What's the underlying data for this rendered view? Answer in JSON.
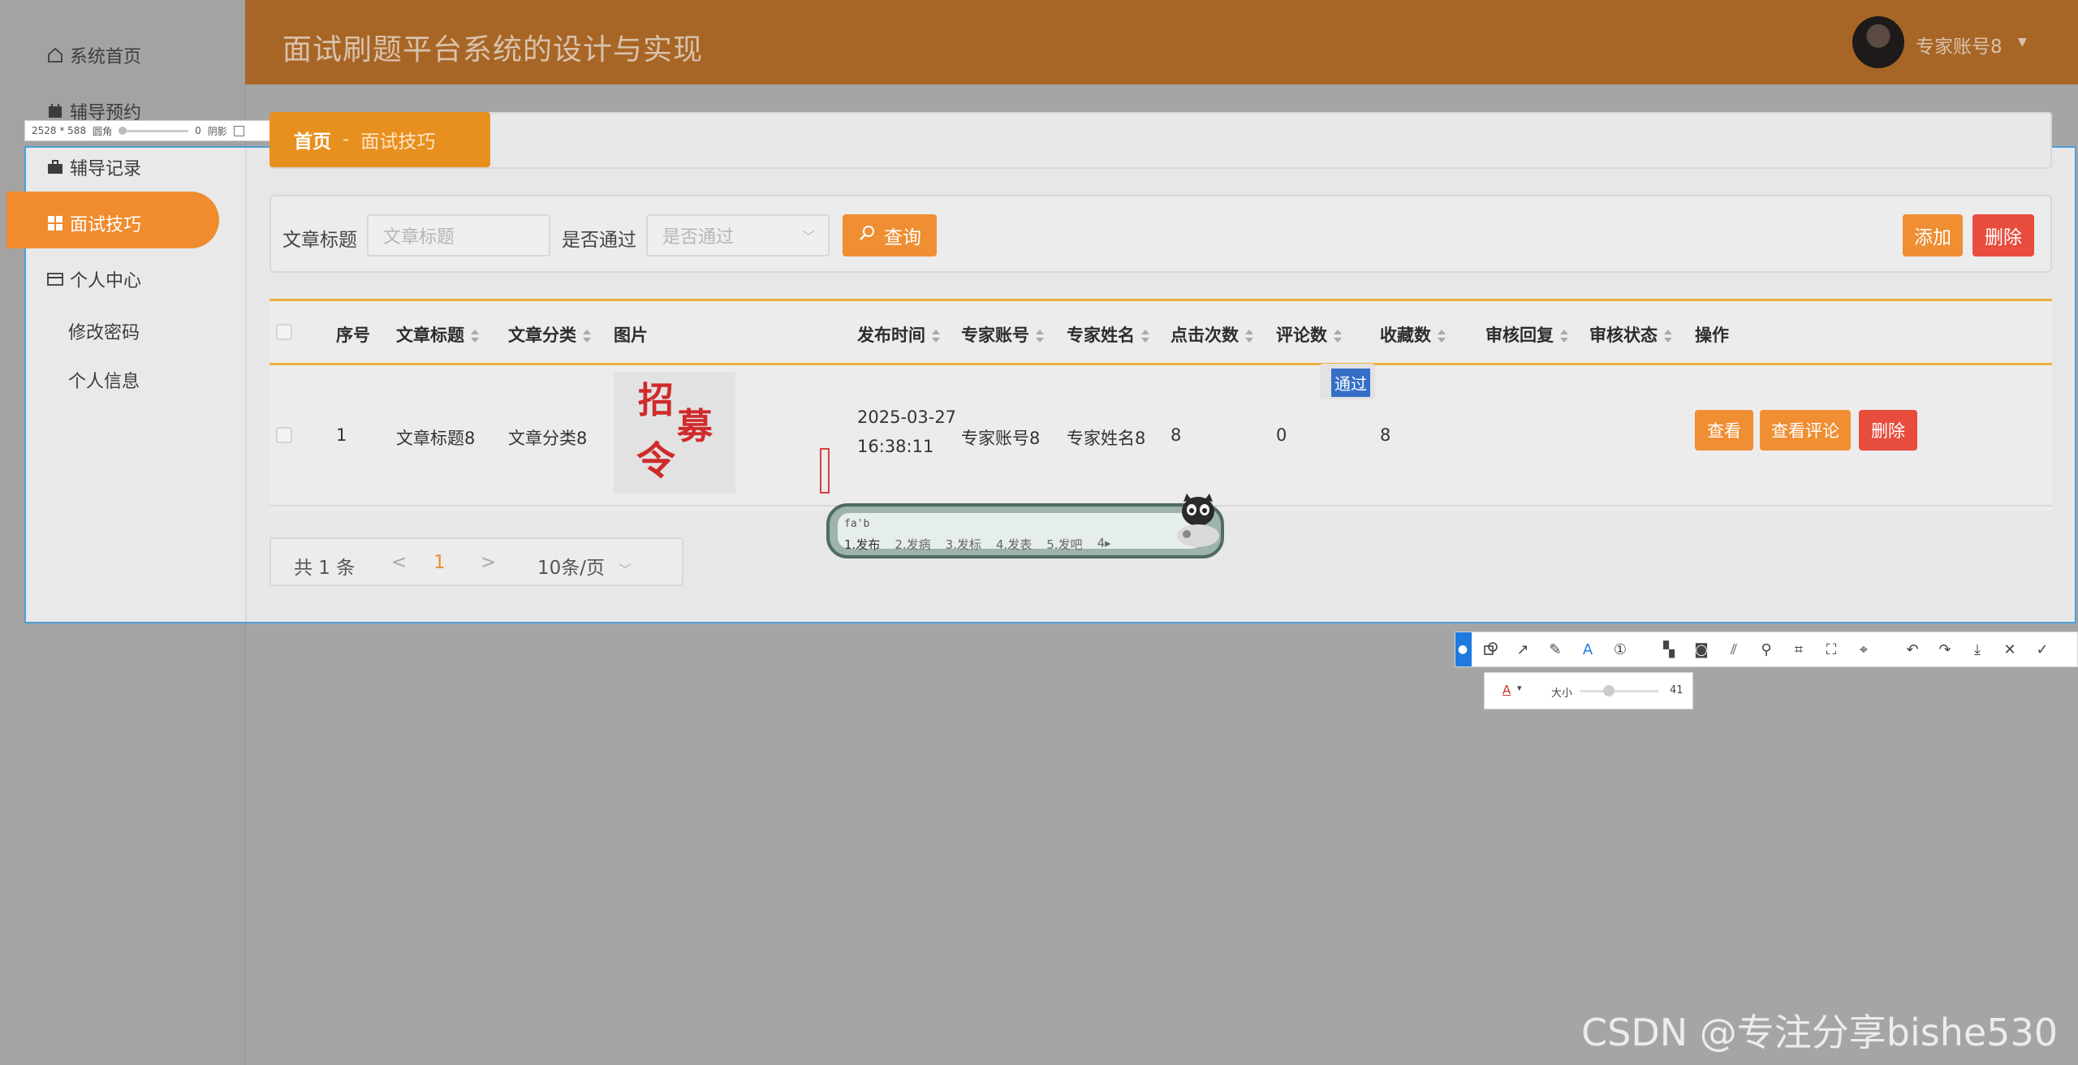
{
  "app": {
    "title": "面试刷题平台系统的设计与实现"
  },
  "user": {
    "name": "专家账号8"
  },
  "sidebar": {
    "items": [
      {
        "label": "系统首页",
        "icon": "home-icon"
      },
      {
        "label": "辅导预约",
        "icon": "calendar-icon"
      },
      {
        "label": "辅导记录",
        "icon": "briefcase-icon"
      },
      {
        "label": "面试技巧",
        "icon": "grid-icon"
      },
      {
        "label": "个人中心",
        "icon": "card-icon"
      }
    ],
    "sub_items": [
      {
        "label": "修改密码"
      },
      {
        "label": "个人信息"
      }
    ]
  },
  "capture_tool": {
    "size_label": "2528 * 588",
    "radius_label": "圆角",
    "radius_value": "0",
    "shadow_label": "阴影",
    "text_size_label": "大小",
    "text_size_value": "41",
    "font_color_label": "A"
  },
  "breadcrumb": {
    "home": "首页",
    "separator": "-",
    "current": "面试技巧"
  },
  "search": {
    "title_label": "文章标题",
    "title_placeholder": "文章标题",
    "pass_label": "是否通过",
    "pass_placeholder": "是否通过",
    "query_button": "查询",
    "add_button": "添加",
    "delete_button": "删除"
  },
  "table": {
    "columns": [
      "序号",
      "文章标题",
      "文章分类",
      "图片",
      "发布时间",
      "专家账号",
      "专家姓名",
      "点击次数",
      "评论数",
      "收藏数",
      "审核回复",
      "审核状态",
      "操作"
    ],
    "rows": [
      {
        "index": "1",
        "title": "文章标题8",
        "category": "文章分类8",
        "image_text": "招募令",
        "date": "2025-03-27",
        "time": "16:38:11",
        "account": "专家账号8",
        "name": "专家姓名8",
        "clicks": "8",
        "comments": "0",
        "favorites": "8",
        "reply": "",
        "status": "通过",
        "actions": {
          "view": "查看",
          "view_comments": "查看评论",
          "delete": "删除"
        }
      }
    ]
  },
  "pagination": {
    "total": "共 1 条",
    "prev": "<",
    "page": "1",
    "next": ">",
    "page_size": "10条/页"
  },
  "ime": {
    "input": "fa'b",
    "candidates": [
      "1.发布",
      "2.发病",
      "3.发标",
      "4.发表",
      "5.发吧"
    ],
    "more": "4▸"
  },
  "watermark": "CSDN @专注分享bishe530",
  "colors": {
    "header": "#a86626",
    "accent": "#ef8e32",
    "danger": "#e84c3d",
    "selection": "#4e9fd6",
    "status": "#356fc7"
  }
}
